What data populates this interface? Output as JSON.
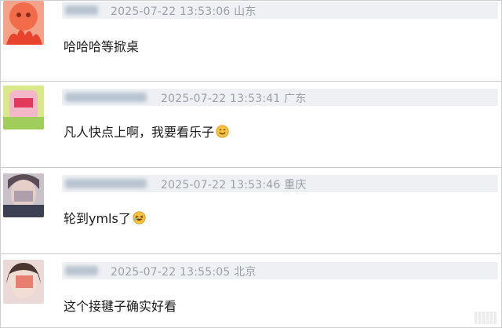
{
  "comments": [
    {
      "time": "2025-07-22 13:53:06",
      "location": "山东",
      "text": "哈哈哈等掀桌",
      "emoji": null
    },
    {
      "time": "2025-07-22 13:53:41",
      "location": "广东",
      "text": "凡人快点上啊，我要看乐子",
      "emoji": "smiling-face-icon"
    },
    {
      "time": "2025-07-22 13:53:46",
      "location": "重庆",
      "text": "轮到ymls了",
      "emoji": "laughing-face-icon"
    },
    {
      "time": "2025-07-22 13:55:05",
      "location": "北京",
      "text": "这个接毽子确实好看",
      "emoji": null
    }
  ],
  "colors": {
    "meta_bar": "#eef0f3",
    "meta_text": "#9aa0a8",
    "divider": "#c9c9c9",
    "emoji_face": "#f7c23c"
  }
}
